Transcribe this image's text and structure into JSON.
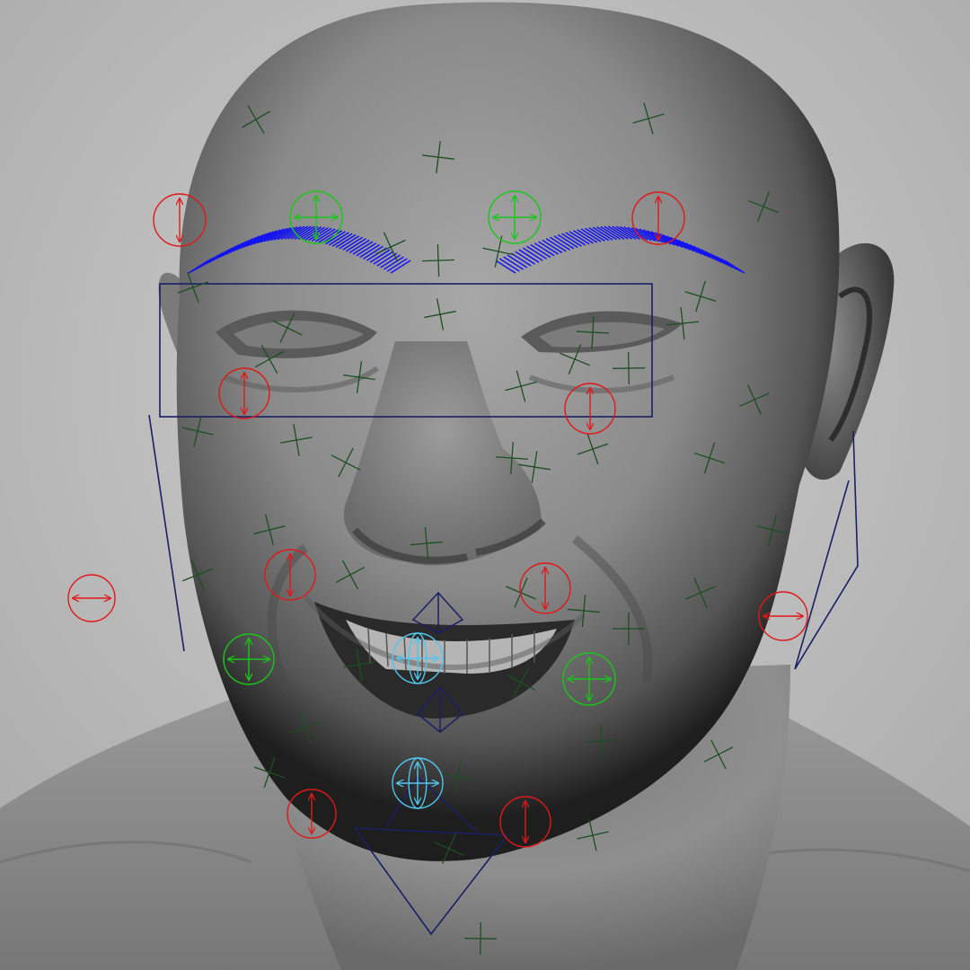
{
  "viewport": {
    "background": "#bdbdbd",
    "mesh_color": "#8a8a8a"
  },
  "colors": {
    "vertical_control": "#e01818",
    "planar_control": "#19c619",
    "mouth_control": "#52c6ee",
    "frame": "#1a1f66",
    "eyebrow_curves": "#1414f0",
    "joint_locators": "#1c4f22"
  },
  "controls": {
    "brow_outer_left": "vertical",
    "brow_inner_left": "planar",
    "brow_inner_right": "planar",
    "brow_outer_right": "vertical",
    "cheek_left": "vertical",
    "cheek_right": "vertical",
    "nose_left": "vertical",
    "nose_right": "vertical",
    "ear_left": "horizontal",
    "ear_right": "horizontal",
    "mouth_corner_left": "planar",
    "mouth_corner_right": "planar",
    "lip_center": "mouth",
    "jaw_center": "mouth",
    "chin_left": "vertical",
    "chin_right": "vertical"
  }
}
